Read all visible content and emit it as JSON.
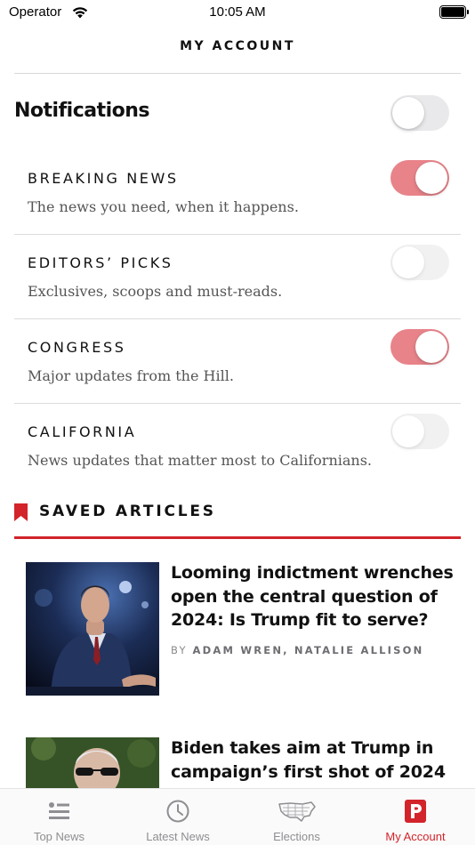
{
  "status_bar": {
    "carrier": "Operator",
    "time": "10:05 AM"
  },
  "header": {
    "title": "MY ACCOUNT"
  },
  "notifications": {
    "title": "Notifications",
    "enabled": false,
    "items": [
      {
        "title": "BREAKING NEWS",
        "description": "The news you need, when it happens.",
        "enabled": true
      },
      {
        "title": "EDITORS’ PICKS",
        "description": "Exclusives, scoops and must-reads.",
        "enabled": false
      },
      {
        "title": "CONGRESS",
        "description": "Major updates from the Hill.",
        "enabled": true
      },
      {
        "title": "CALIFORNIA",
        "description": "News updates that matter most to Californians.",
        "enabled": false
      }
    ]
  },
  "saved_articles": {
    "title": "SAVED ARTICLES",
    "articles": [
      {
        "headline": "Looming indictment wrenches open the central question of 2024: Is Trump fit to serve?",
        "byline_prefix": "BY",
        "authors": "ADAM WREN, NATALIE ALLISON"
      },
      {
        "headline": "Biden takes aim at Trump in campaign’s first shot of 2024"
      }
    ]
  },
  "tab_bar": {
    "tabs": [
      {
        "label": "Top News",
        "icon": "list-icon",
        "active": false
      },
      {
        "label": "Latest News",
        "icon": "clock-icon",
        "active": false
      },
      {
        "label": "Elections",
        "icon": "us-map-icon",
        "active": false
      },
      {
        "label": "My Account",
        "icon": "politico-p-icon",
        "active": true
      }
    ]
  },
  "colors": {
    "accent": "#d2242a",
    "toggle_on": "#e8838a",
    "toggle_off": "#e9e9eb",
    "inactive_tab": "#8e8e93"
  }
}
